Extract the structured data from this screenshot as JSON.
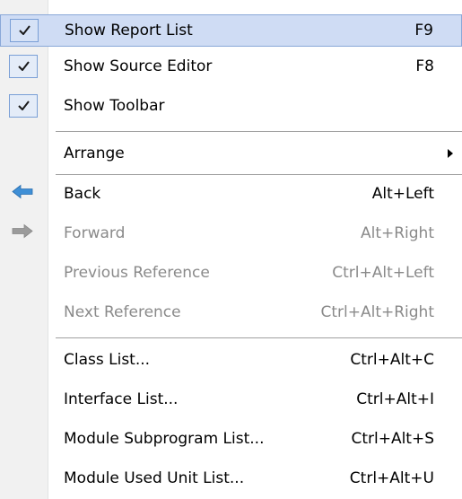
{
  "menu": {
    "show_report_list": {
      "label": "Show Report List",
      "shortcut": "F9",
      "checked": true
    },
    "show_source_editor": {
      "label": "Show Source Editor",
      "shortcut": "F8",
      "checked": true
    },
    "show_toolbar": {
      "label": "Show Toolbar",
      "shortcut": "",
      "checked": true
    },
    "arrange": {
      "label": "Arrange",
      "has_submenu": true
    },
    "back": {
      "label": "Back",
      "shortcut": "Alt+Left",
      "icon": "back-arrow-icon",
      "enabled": true
    },
    "forward": {
      "label": "Forward",
      "shortcut": "Alt+Right",
      "icon": "forward-arrow-icon",
      "enabled": false
    },
    "previous_reference": {
      "label": "Previous Reference",
      "shortcut": "Ctrl+Alt+Left",
      "enabled": false
    },
    "next_reference": {
      "label": "Next Reference",
      "shortcut": "Ctrl+Alt+Right",
      "enabled": false
    },
    "class_list": {
      "label": "Class List...",
      "shortcut": "Ctrl+Alt+C"
    },
    "interface_list": {
      "label": "Interface List...",
      "shortcut": "Ctrl+Alt+I"
    },
    "module_subprogram_list": {
      "label": "Module Subprogram List...",
      "shortcut": "Ctrl+Alt+S"
    },
    "module_used_unit_list": {
      "label": "Module Used Unit List...",
      "shortcut": "Ctrl+Alt+U"
    }
  },
  "colors": {
    "highlight_bg": "#cfdcf4",
    "highlight_border": "#8aa8d8",
    "disabled_text": "#8a8a8a",
    "back_arrow": "#3f8fd6",
    "forward_arrow": "#9b9b9b"
  }
}
